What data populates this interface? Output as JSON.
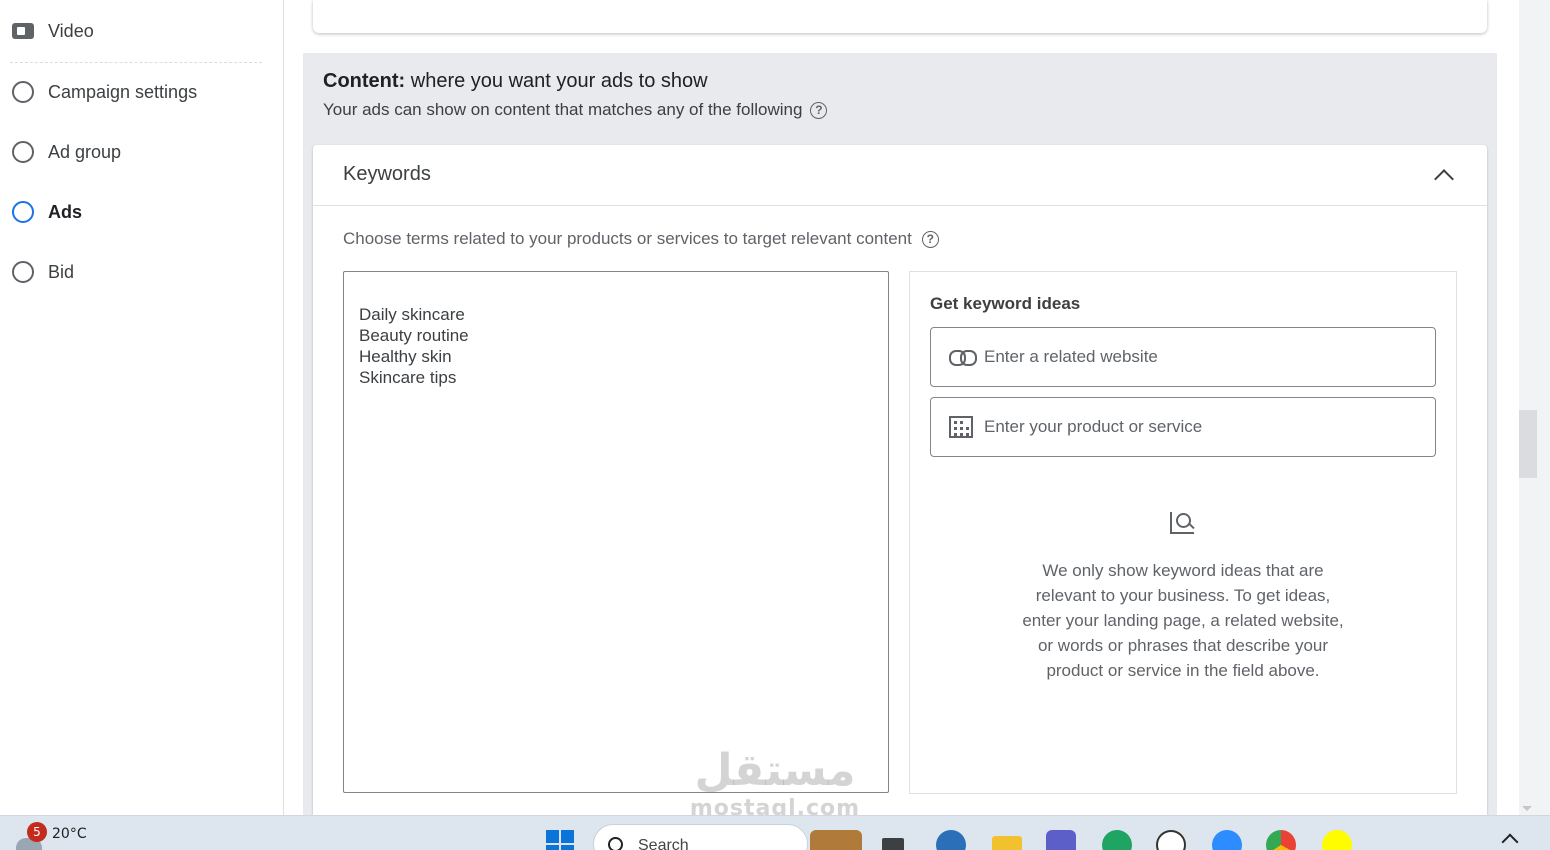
{
  "sidebar": {
    "items": [
      {
        "label": "Video",
        "icon": "video-icon"
      },
      {
        "label": "Campaign settings",
        "state": "unselected"
      },
      {
        "label": "Ad group",
        "state": "unselected"
      },
      {
        "label": "Ads",
        "state": "active"
      },
      {
        "label": "Bid",
        "state": "unselected"
      }
    ]
  },
  "content_section": {
    "title_bold": "Content:",
    "title_rest": " where you want your ads to show",
    "subtitle": "Your ads can show on content that matches any of the following",
    "help_icon": "?"
  },
  "keywords": {
    "title": "Keywords",
    "description": "Choose terms related to your products or services to target relevant content",
    "help_icon": "?",
    "entries": [
      "Daily skincare",
      "Beauty routine",
      "Healthy skin",
      "Skincare tips"
    ]
  },
  "keyword_ideas": {
    "title": "Get keyword ideas",
    "website_placeholder": "Enter a related website",
    "product_placeholder": "Enter your product or service",
    "info_text": "We only show keyword ideas that are relevant to your business. To get ideas, enter your landing page, a related website, or words or phrases that describe your product or service in the field above."
  },
  "watermark": {
    "arabic": "مستقل",
    "latin": "mostaql.com"
  },
  "taskbar": {
    "weather_temp": "20°C",
    "notification_count": "5",
    "search_label": "Search",
    "apps": [
      "store-app-icon",
      "task-view-icon",
      "edge-beta-icon",
      "file-explorer-icon",
      "teams-icon",
      "edge-icon",
      "panda-app-icon",
      "zoom-icon",
      "chrome-icon",
      "snapchat-icon"
    ]
  },
  "colors": {
    "accent": "#1a73e8",
    "panel_gray": "#e8eaed",
    "text_primary": "#3c4043"
  }
}
